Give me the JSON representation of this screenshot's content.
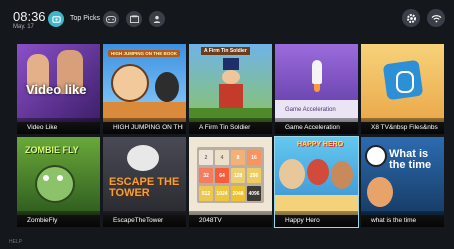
{
  "status": {
    "time": "08:36",
    "date": "May. 17"
  },
  "nav": {
    "top_picks_label": "Top Picks"
  },
  "apps": [
    {
      "title": "Video Like",
      "art_text": "Video like",
      "color": "#6b2fa0"
    },
    {
      "title": "HIGH JUMPING ON THE BOOK",
      "art_text": "HIGH JUMPING ON THE BOOK",
      "color": "#2a7ac7"
    },
    {
      "title": "A Firm Tin Soldier",
      "art_text": "A Firm Tin Soldier",
      "color": "#3a6b2a"
    },
    {
      "title": "Game Acceleration",
      "art_text": "Game Acceleration",
      "color": "#8a4fd0"
    },
    {
      "title": "X8 TV&nbsp Files&nbs",
      "art_text": "",
      "color": "#f2c05a"
    },
    {
      "title": "ZombieFly",
      "art_text": "ZOMBIE FLY",
      "color": "#4e8a2e"
    },
    {
      "title": "EscapeTheTower",
      "art_text": "ESCAPE THE TOWER",
      "color": "#c0653a"
    },
    {
      "title": "2048TV",
      "art_text": "",
      "color": "#efe6d6"
    },
    {
      "title": "Happy Hero",
      "art_text": "HAPPY HERO",
      "color": "#3dbbe3"
    },
    {
      "title": "what is the time",
      "art_text": "What is the time",
      "color": "#1f4f8a"
    }
  ],
  "tiles_2048": [
    "2",
    "4",
    "8",
    "16",
    "32",
    "64",
    "128",
    "256",
    "512",
    "1024",
    "2048",
    "4096"
  ],
  "help_label": "HELP"
}
